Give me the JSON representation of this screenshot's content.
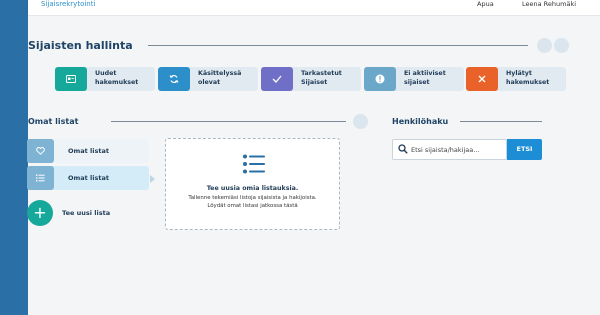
{
  "header": {
    "app_title": "Sijaisrekrytointi",
    "help": "Apua",
    "user": "Leena Rehumäki"
  },
  "page": {
    "title": "Sijaisten hallinta"
  },
  "status_cards": [
    {
      "line1": "Uudet",
      "line2": "hakemukset",
      "icon": "id-card-icon",
      "color": "#16a89a"
    },
    {
      "line1": "Käsittelyssä",
      "line2": "olevat",
      "icon": "refresh-icon",
      "color": "#2c8fc9"
    },
    {
      "line1": "Tarkastetut",
      "line2": "Sijaiset",
      "icon": "check-icon",
      "color": "#6f6fc8"
    },
    {
      "line1": "Ei aktiiviset",
      "line2": "sijaiset",
      "icon": "exclamation-icon",
      "color": "#6aa7c9"
    },
    {
      "line1": "Hylätyt",
      "line2": "hakemukset",
      "icon": "close-icon",
      "color": "#e8622a"
    }
  ],
  "lists": {
    "title": "Omat listat",
    "items": [
      {
        "label": "Omat listat",
        "icon": "heart-icon"
      },
      {
        "label": "Omat listat",
        "icon": "list-icon"
      }
    ],
    "add_label": "Tee uusi lista",
    "empty": {
      "title": "Tee uusia omia listauksia.",
      "line1": "Tallenne tekemiäsi listoja sijaisista ja hakijoista.",
      "line2": "Löydät omat listasi jatkossa tästä"
    }
  },
  "search": {
    "title": "Henkilöhaku",
    "placeholder": "Etsi sijaista/hakijaa...",
    "button": "ETSI"
  }
}
